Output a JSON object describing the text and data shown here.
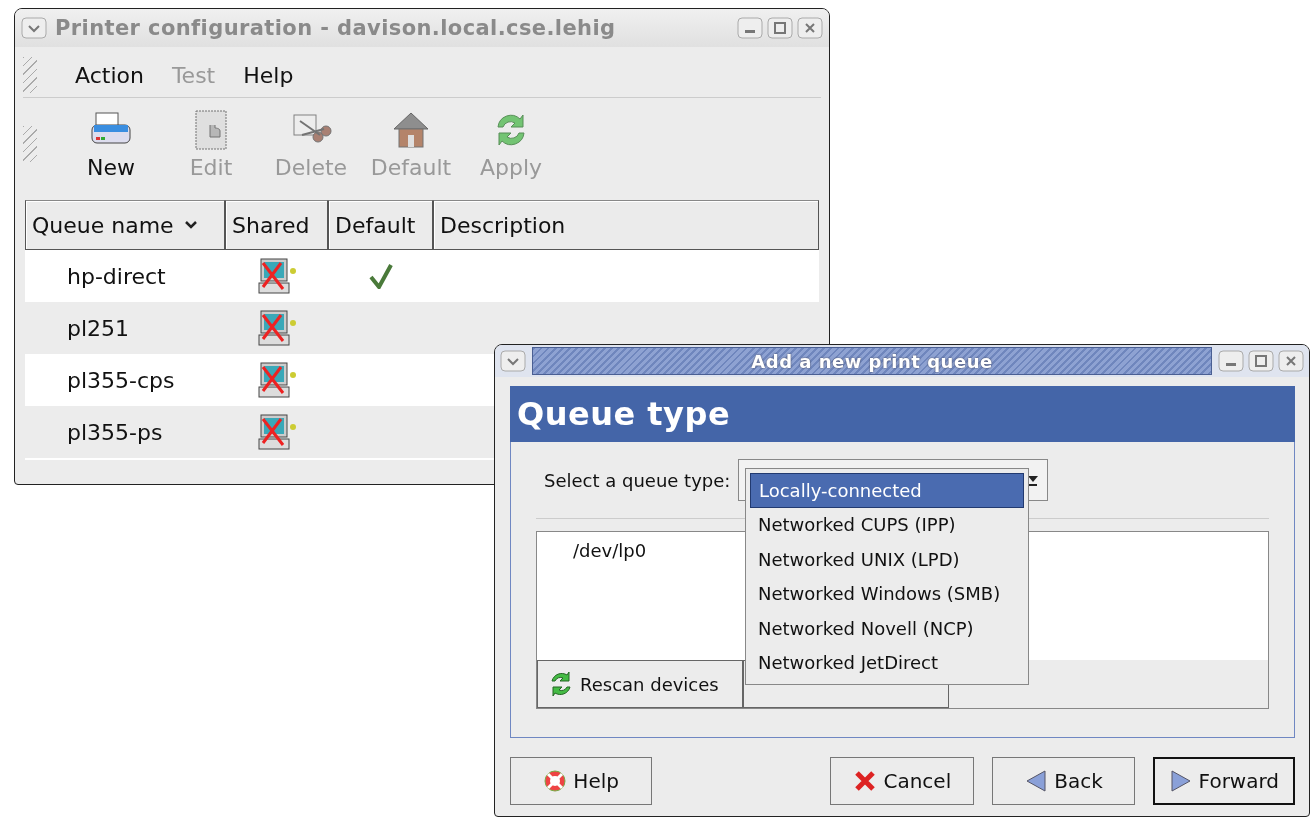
{
  "printer_window": {
    "title": "Printer configuration - davison.local.cse.lehig",
    "menu": [
      {
        "label": "Action",
        "disabled": false
      },
      {
        "label": "Test",
        "disabled": true
      },
      {
        "label": "Help",
        "disabled": false
      }
    ],
    "toolbar": [
      {
        "kind": "new",
        "label": "New",
        "disabled": false
      },
      {
        "kind": "edit",
        "label": "Edit",
        "disabled": true
      },
      {
        "kind": "delete",
        "label": "Delete",
        "disabled": true
      },
      {
        "kind": "default",
        "label": "Default",
        "disabled": true
      },
      {
        "kind": "apply",
        "label": "Apply",
        "disabled": true
      }
    ],
    "table": {
      "columns": [
        "Queue name",
        "Shared",
        "Default",
        "Description"
      ],
      "rows": [
        {
          "queue_name": "hp-direct",
          "shared": false,
          "default": true
        },
        {
          "queue_name": "pl251",
          "shared": false,
          "default": false
        },
        {
          "queue_name": "pl355-cps",
          "shared": false,
          "default": false
        },
        {
          "queue_name": "pl355-ps",
          "shared": false,
          "default": false
        }
      ]
    }
  },
  "dialog": {
    "title": "Add a new print queue",
    "heading": "Queue type",
    "queue_type_label": "Select a queue type:",
    "queue_type_options": [
      {
        "label": "Locally-connected",
        "selected": true
      },
      {
        "label": "Networked CUPS (IPP)",
        "selected": false
      },
      {
        "label": "Networked UNIX (LPD)",
        "selected": false
      },
      {
        "label": "Networked Windows (SMB)",
        "selected": false
      },
      {
        "label": "Networked Novell (NCP)",
        "selected": false
      },
      {
        "label": "Networked JetDirect",
        "selected": false
      }
    ],
    "devices": [
      "/dev/lp0"
    ],
    "device_buttons": [
      {
        "kind": "rescan",
        "label": "Rescan devices"
      }
    ],
    "buttons": [
      {
        "kind": "help",
        "label": "Help",
        "default": false
      },
      {
        "kind": "cancel",
        "label": "Cancel",
        "default": false
      },
      {
        "kind": "back",
        "label": "Back",
        "default": false
      },
      {
        "kind": "forward",
        "label": "Forward",
        "default": true
      }
    ]
  }
}
